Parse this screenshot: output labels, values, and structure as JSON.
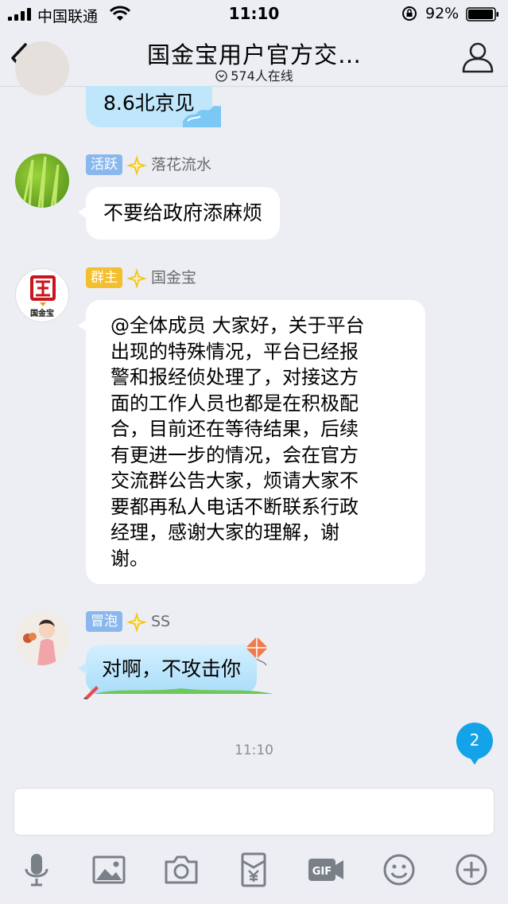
{
  "status_bar": {
    "carrier": "中国联通",
    "time": "11:10",
    "battery": "92%"
  },
  "header": {
    "title": "国金宝用户官方交…",
    "online": "574人在线"
  },
  "messages": [
    {
      "text": "8.6北京见"
    },
    {
      "badge": "活跃",
      "sender": "落花流水",
      "text": "不要给政府添麻烦"
    },
    {
      "badge": "群主",
      "sender": "国金宝",
      "text": "@全体成员 大家好，关于平台\n出现的特殊情况，平台已经报\n警和报经侦处理了，对接这方\n面的工作人员也都是在积极配\n合，目前还在等待结果，后续\n有更进一步的情况，会在官方\n交流群公告大家，烦请大家不\n要都再私人电话不断联系行政\n经理，感谢大家的理解，谢\n谢。",
      "avatar_text": "国金宝"
    },
    {
      "badge": "冒泡",
      "sender": "SS",
      "text": "对啊，不攻击你"
    }
  ],
  "timestamp": "11:10",
  "unread_count": "2",
  "input": {
    "placeholder": ""
  },
  "toolbar": [
    "mic-icon",
    "image-icon",
    "camera-icon",
    "red-packet-icon",
    "gif-icon",
    "emoji-icon",
    "plus-icon"
  ],
  "colors": {
    "background": "#eceef3",
    "accent": "#12a3e8",
    "badge_blue": "#8ab8ee",
    "badge_gold": "#f3bf2e"
  }
}
